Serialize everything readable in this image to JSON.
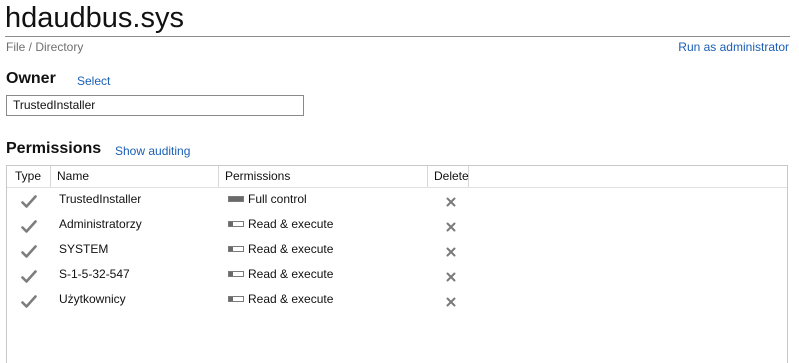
{
  "header": {
    "title": "hdaudbus.sys",
    "subtitle": "File / Directory",
    "run_as_admin": "Run as administrator"
  },
  "owner": {
    "heading": "Owner",
    "select_label": "Select",
    "value": "TrustedInstaller"
  },
  "permissions": {
    "heading": "Permissions",
    "show_auditing_label": "Show auditing",
    "columns": [
      "Type",
      "Name",
      "Permissions",
      "Delete"
    ],
    "rows": [
      {
        "name": "TrustedInstaller",
        "permission": "Full control",
        "level": 1.0
      },
      {
        "name": "Administratorzy",
        "permission": "Read & execute",
        "level": 0.25
      },
      {
        "name": "SYSTEM",
        "permission": "Read & execute",
        "level": 0.25
      },
      {
        "name": "S-1-5-32-547",
        "permission": "Read & execute",
        "level": 0.25
      },
      {
        "name": "Użytkownicy",
        "permission": "Read & execute",
        "level": 0.25
      }
    ]
  },
  "colors": {
    "link": "#1a5fb4",
    "icon_gray": "#7d7d7d"
  },
  "icons": {
    "type": "allow-check-icon",
    "delete": "delete-x-icon"
  }
}
